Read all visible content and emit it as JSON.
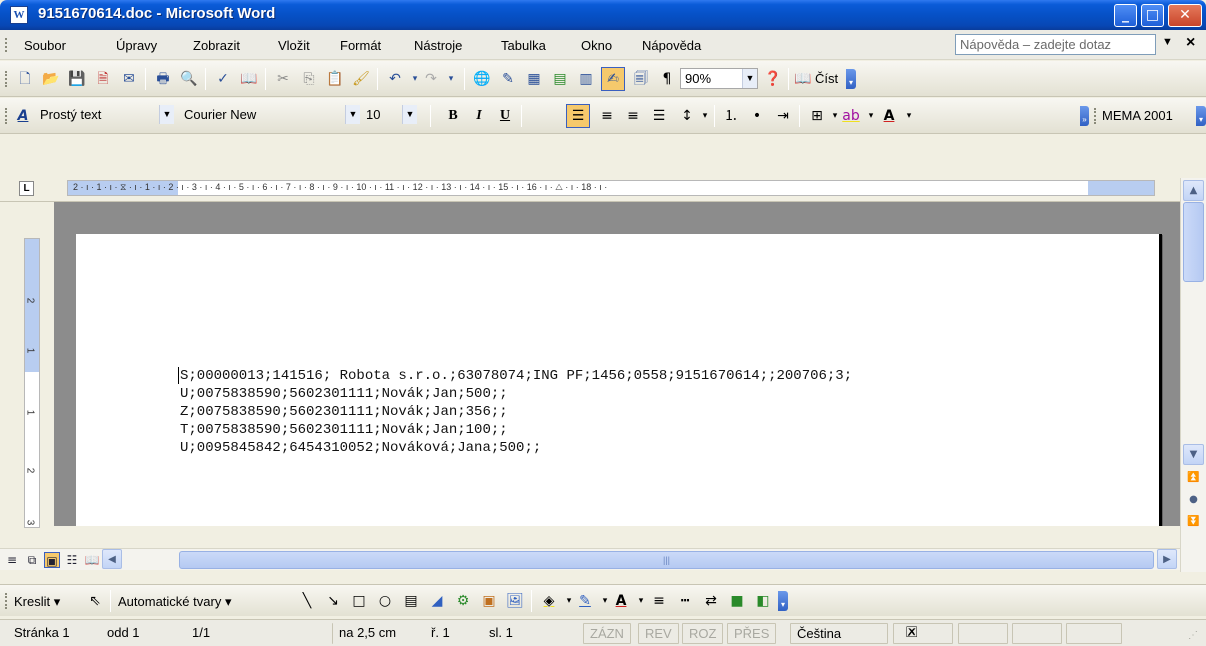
{
  "window": {
    "title": "9151670614.doc - Microsoft Word",
    "app_icon_letter": "W",
    "minimize": "_",
    "maximize": "□",
    "close": "✕"
  },
  "menu": {
    "items": [
      "Soubor",
      "Úpravy",
      "Zobrazit",
      "Vložit",
      "Formát",
      "Nástroje",
      "Tabulka",
      "Okno",
      "Nápověda"
    ],
    "help_placeholder": "Nápověda – zadejte dotaz",
    "close_glyph": "×"
  },
  "standard_toolbar": {
    "zoom": "90%",
    "read_label": "Číst"
  },
  "format_toolbar": {
    "style": "Prostý text",
    "style_icon": "A",
    "font": "Courier New",
    "size": "10",
    "bold": "B",
    "italic": "I",
    "underline": "U",
    "extra_label": "MEMA 2001"
  },
  "ruler": {
    "ticks": "2 · ı · 1 · ı · ⧖ · ı · 1 · ı · 2 · ı · 3 · ı · 4 · ı · 5 · ı · 6 · ı · 7 · ı · 8 · ı · 9 · ı · 10 · ı · 11 · ı · 12 · ı · 13 · ı · 14 · ı · 15 · ı · 16 · ı · △ · ı · 18 · ı ·",
    "tab_selector": "L",
    "vertical_numbers": [
      "2",
      "1",
      "1",
      "2",
      "3"
    ]
  },
  "document": {
    "lines": [
      "S;00000013;141516; Robota s.r.o.;63078074;ING PF;1456;0558;9151670614;;200706;3;",
      "U;0075838590;5602301111;Novák;Jan;500;;",
      "Z;0075838590;5602301111;Novák;Jan;356;;",
      "T;0075838590;5602301111;Novák;Jan;100;;",
      "U;0095845842;6454310052;Nováková;Jana;500;;"
    ]
  },
  "scrollbars": {
    "h_thumb_grip": "|||"
  },
  "drawing_toolbar": {
    "draw_label": "Kreslit",
    "autoshapes_label": "Automatické tvary"
  },
  "status": {
    "page": "Stránka 1",
    "section": "odd 1",
    "pages": "1/1",
    "at": "na 2,5 cm",
    "line": "ř. 1",
    "col": "sl. 1",
    "rec": "ZÁZN",
    "trk": "REV",
    "ext": "ROZ",
    "ovr": "PŘES",
    "language": "Čeština"
  }
}
